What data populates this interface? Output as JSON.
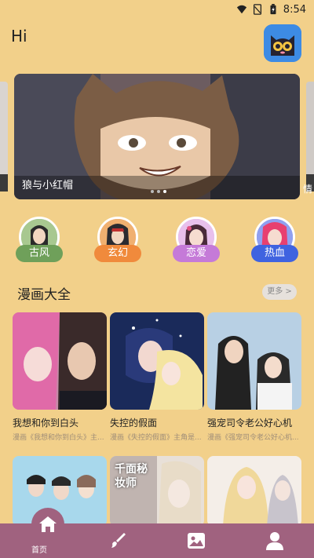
{
  "status": {
    "time": "8:54"
  },
  "header": {
    "greeting": "Hi",
    "app_icon": "cat-icon"
  },
  "banner": {
    "title": "狼与小红帽",
    "side_label": "情",
    "dots_count": 3,
    "active_dot": 3
  },
  "categories": [
    {
      "label": "古风",
      "color": "#6fa05a"
    },
    {
      "label": "玄幻",
      "color": "#f08a3c"
    },
    {
      "label": "恋爱",
      "color": "#c57ad8"
    },
    {
      "label": "热血",
      "color": "#3f63e0"
    }
  ],
  "section": {
    "title": "漫画大全",
    "more": "更多 >"
  },
  "comics": [
    {
      "title": "我想和你到白头",
      "desc": "漫画《我想和你到白头》主..."
    },
    {
      "title": "失控的假面",
      "desc": "漫画《失控的假面》主角是..."
    },
    {
      "title": "强宠司令老公好心机",
      "desc": "漫画《强宠司令老公好心机..."
    },
    {
      "title": "",
      "desc": ""
    },
    {
      "title": "",
      "desc": ""
    },
    {
      "title": "",
      "desc": ""
    }
  ],
  "thumb_text": "千面秘妆师",
  "tabs": [
    {
      "label": "首页",
      "icon": "home-icon"
    },
    {
      "label": "",
      "icon": "brush-icon"
    },
    {
      "label": "",
      "icon": "image-icon"
    },
    {
      "label": "",
      "icon": "user-icon"
    }
  ],
  "colors": {
    "background": "#f2d08a",
    "tabbar": "#a0627f",
    "more_bg": "#e6e1dc"
  }
}
